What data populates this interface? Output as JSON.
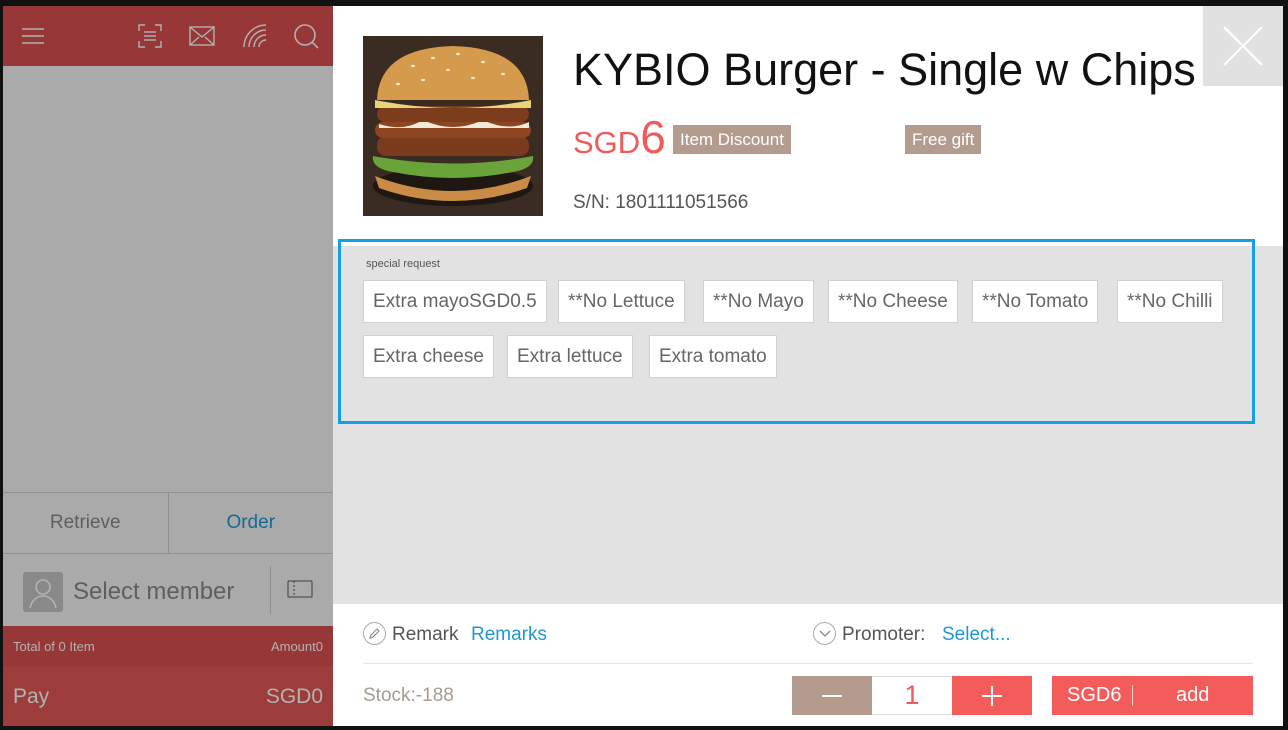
{
  "pos": {
    "tabs": {
      "retrieve": "Retrieve",
      "order": "Order"
    },
    "member": {
      "label": "Select member"
    },
    "totals": {
      "items": "Total of 0 Item",
      "amount": "Amount0"
    },
    "pay": {
      "label": "Pay",
      "amount": "SGD0"
    }
  },
  "product": {
    "name": "KYBIO Burger - Single w Chips",
    "price_currency": "SGD",
    "price_value": "6",
    "tags": {
      "discount": "Item Discount",
      "gift": "Free gift"
    },
    "serial": "S/N: 1801111051566"
  },
  "special_request": {
    "label": "special request",
    "options": [
      "Extra mayoSGD0.5",
      "**No Lettuce",
      "**No Mayo",
      "**No Cheese",
      "**No Tomato",
      "**No Chilli",
      "Extra cheese",
      "Extra lettuce",
      "Extra tomato"
    ]
  },
  "footer": {
    "remark_label": "Remark",
    "remark_link": "Remarks",
    "promoter_label": "Promoter:",
    "promoter_link": "Select...",
    "stock": "Stock:-188",
    "quantity": "1",
    "add_amount": "SGD6",
    "add_label": "add"
  },
  "colors": {
    "brand_red": "#d9504f",
    "price_red": "#f05a5a",
    "tag_taupe": "#b39c8e",
    "link_blue": "#1f97d4",
    "focus_blue": "#11a0e4"
  }
}
